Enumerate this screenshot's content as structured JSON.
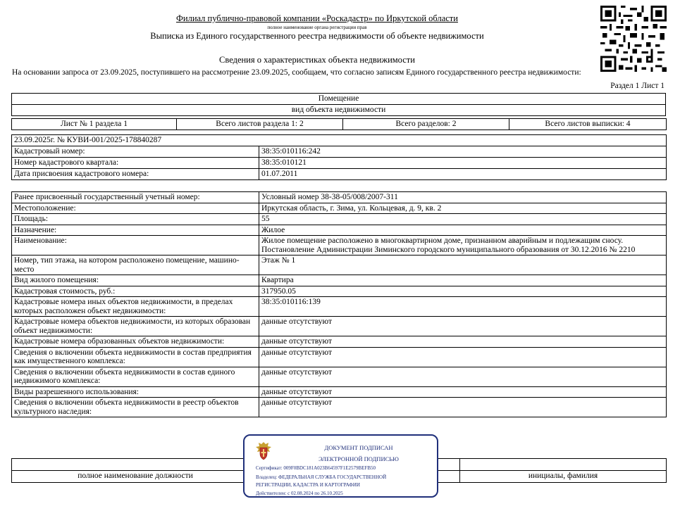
{
  "header": {
    "organization": "Филиал публично-правовой компании «Роскадастр» по Иркутской области",
    "organization_note": "полное наименование органа регистрации прав",
    "extract_title": "Выписка из Единого государственного реестра недвижимости об объекте недвижимости",
    "section_title": "Сведения о характеристиках объекта недвижимости",
    "basis": "На  основании запроса от 23.09.2025, поступившего на рассмотрение 23.09.2025, сообщаем, что согласно записям Единого государственного реестра недвижимости:",
    "section_sheet": "Раздел 1 Лист 1"
  },
  "object": {
    "type_value": "Помещение",
    "type_label": "вид объекта недвижимости"
  },
  "sheets": {
    "sheet": "Лист № 1 раздела 1",
    "total_section_sheets": "Всего листов раздела 1: 2",
    "total_sections": "Всего разделов: 2",
    "total_extract_sheets": "Всего листов выписки: 4"
  },
  "request": {
    "number": "23.09.2025г. № КУВИ-001/2025-178840287",
    "rows": [
      {
        "label": "Кадастровый номер:",
        "value": "38:35:010116:242"
      },
      {
        "label": "Номер кадастрового квартала:",
        "value": "38:35:010121"
      },
      {
        "label": "Дата присвоения кадастрового номера:",
        "value": "01.07.2011"
      }
    ]
  },
  "details": [
    {
      "label": "Ранее присвоенный государственный учетный номер:",
      "value": "Условный номер 38-38-05/008/2007-311"
    },
    {
      "label": "Местоположение:",
      "value": "Иркутская область, г. Зима, ул. Кольцевая, д. 9, кв. 2"
    },
    {
      "label": "Площадь:",
      "value": "55"
    },
    {
      "label": "Назначение:",
      "value": "Жилое"
    },
    {
      "label": "Наименование:",
      "value": "Жилое помещение расположено в многоквартирном доме, признанном аварийным и подлежащим сносу. Постановление Администрации Зиминского городского муниципального образования от 30.12.2016 № 2210"
    },
    {
      "label": "Номер, тип этажа, на котором расположено помещение, машино-место",
      "value": "Этаж № 1"
    },
    {
      "label": "Вид жилого помещения:",
      "value": "Квартира"
    },
    {
      "label": "Кадастровая стоимость, руб.:",
      "value": "317950.05"
    },
    {
      "label": "Кадастровые номера иных объектов недвижимости, в пределах которых расположен объект недвижимости:",
      "value": "38:35:010116:139"
    },
    {
      "label": "Кадастровые номера объектов недвижимости, из которых образован объект недвижимости:",
      "value": "данные отсутствуют"
    },
    {
      "label": "Кадастровые номера образованных объектов недвижимости:",
      "value": "данные отсутствуют"
    },
    {
      "label": "Сведения о включении объекта недвижимости в состав предприятия как имущественного комплекса:",
      "value": "данные отсутствуют"
    },
    {
      "label": "Сведения о включении объекта недвижимости в состав единого недвижимого комплекса:",
      "value": "данные отсутствуют"
    },
    {
      "label": "Виды разрешенного использования:",
      "value": "данные отсутствуют"
    },
    {
      "label": "Сведения о включении объекта недвижимости в реестр объектов культурного наследия:",
      "value": "данные отсутствуют"
    }
  ],
  "signature": {
    "position_label": "полное наименование должности",
    "name_label": "инициалы, фамилия"
  },
  "stamp": {
    "title": "ДОКУМЕНТ ПОДПИСАН",
    "subtitle": "ЭЛЕКТРОННОЙ ПОДПИСЬЮ",
    "certificate": "Сертификат: 009F0BDC181A023B64597F1E2579BEFB50",
    "owner": "Владелец: ФЕДЕРАЛЬНАЯ СЛУЖБА ГОСУДАРСТВЕННОЙ",
    "owner_cont": "РЕГИСТРАЦИИ, КАДАСТРА И КАРТОГРАФИИ",
    "valid": "Действителен: с 02.08.2024 по 26.10.2025",
    "color": "#1f2f7a",
    "emblem_color": "#c0392b"
  },
  "icons": {
    "qr": "qr-code-icon",
    "emblem": "coat-of-arms-emblem-icon"
  }
}
